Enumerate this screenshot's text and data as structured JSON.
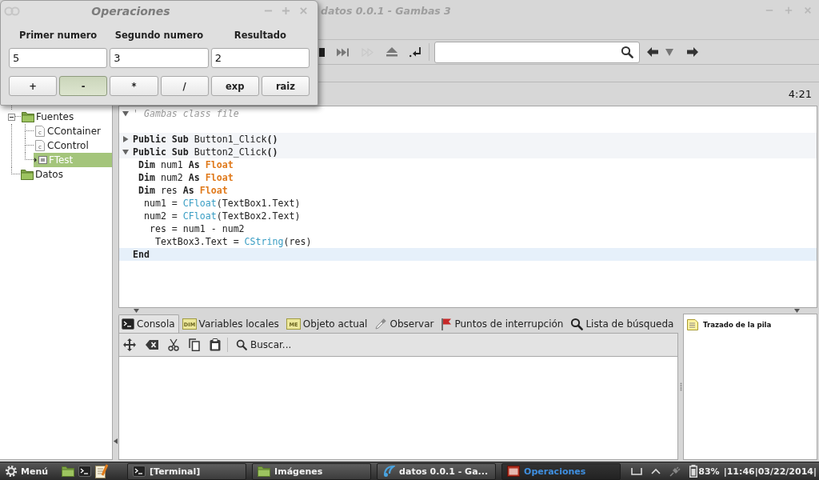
{
  "dialog": {
    "title": "Operaciones",
    "fields": [
      {
        "label": "Primer numero",
        "value": "5"
      },
      {
        "label": "Segundo numero",
        "value": "3"
      },
      {
        "label": "Resultado",
        "value": "2"
      }
    ],
    "buttons": [
      {
        "label": "+",
        "pressed": false
      },
      {
        "label": "-",
        "pressed": true
      },
      {
        "label": "*",
        "pressed": false
      },
      {
        "label": "/",
        "pressed": false
      },
      {
        "label": "exp",
        "pressed": false
      },
      {
        "label": "raiz",
        "pressed": false
      }
    ]
  },
  "main_window": {
    "title": "datos 0.0.1 - Gambas 3",
    "toolbar": {
      "buttons": [
        {
          "kind": "stop",
          "disabled": false
        },
        {
          "kind": "step",
          "disabled": false
        },
        {
          "kind": "forward",
          "disabled": true
        },
        {
          "kind": "eject",
          "disabled": false
        },
        {
          "kind": "return",
          "disabled": false
        }
      ],
      "navigation": [
        {
          "kind": "back"
        },
        {
          "kind": "history"
        },
        {
          "kind": "forward"
        }
      ]
    },
    "project_tree": {
      "items": [
        {
          "label": "Fuentes",
          "kind": "folder",
          "expanded": true,
          "selected": false,
          "children": [
            {
              "label": "CContainer",
              "kind": "class",
              "icon_label": "c",
              "selected": false
            },
            {
              "label": "CControl",
              "kind": "class",
              "icon_label": "c",
              "selected": false
            },
            {
              "label": "FTest",
              "kind": "form",
              "selected": true
            }
          ]
        },
        {
          "label": "Datos",
          "kind": "folder",
          "selected": false
        }
      ]
    },
    "editor": {
      "cursor_position": "4:21",
      "lines": [
        {
          "kind": "code",
          "expanded": true,
          "current": false,
          "tokens": [
            {
              "kind": "comment",
              "text": "' Gambas class file"
            }
          ]
        },
        {
          "kind": "blank",
          "current": false
        },
        {
          "kind": "procedure",
          "expanded": false,
          "current": false,
          "tokens": [
            {
              "kind": "keyword",
              "text": "Public Sub"
            },
            {
              "kind": "plain",
              "text": " Button1_Click"
            },
            {
              "kind": "symbol",
              "text": "()"
            }
          ]
        },
        {
          "kind": "procedure",
          "expanded": true,
          "current": false,
          "tokens": [
            {
              "kind": "keyword",
              "text": "Public Sub"
            },
            {
              "kind": "plain",
              "text": " Button2_Click"
            },
            {
              "kind": "symbol",
              "text": "()"
            }
          ]
        },
        {
          "kind": "code",
          "current": false,
          "tokens": [
            {
              "kind": "keyword",
              "text": " Dim"
            },
            {
              "kind": "plain",
              "text": " num1 "
            },
            {
              "kind": "keyword",
              "text": "As"
            },
            {
              "kind": "type",
              "text": " Float"
            }
          ]
        },
        {
          "kind": "code",
          "current": false,
          "tokens": [
            {
              "kind": "keyword",
              "text": " Dim"
            },
            {
              "kind": "plain",
              "text": " num2 "
            },
            {
              "kind": "keyword",
              "text": "As"
            },
            {
              "kind": "type",
              "text": " Float"
            }
          ]
        },
        {
          "kind": "code",
          "current": false,
          "tokens": [
            {
              "kind": "keyword",
              "text": " Dim"
            },
            {
              "kind": "plain",
              "text": " res "
            },
            {
              "kind": "keyword",
              "text": "As"
            },
            {
              "kind": "type",
              "text": " Float"
            }
          ]
        },
        {
          "kind": "code",
          "current": false,
          "tokens": [
            {
              "kind": "plain",
              "text": "  num1 = "
            },
            {
              "kind": "function",
              "text": "CFloat"
            },
            {
              "kind": "plain",
              "text": "(TextBox1.Text)"
            }
          ]
        },
        {
          "kind": "code",
          "current": false,
          "tokens": [
            {
              "kind": "plain",
              "text": "  num2 = "
            },
            {
              "kind": "function",
              "text": "CFloat"
            },
            {
              "kind": "plain",
              "text": "(TextBox2.Text)"
            }
          ]
        },
        {
          "kind": "code",
          "current": false,
          "tokens": [
            {
              "kind": "plain",
              "text": "   res = num1 - num2"
            }
          ]
        },
        {
          "kind": "code",
          "current": false,
          "tokens": [
            {
              "kind": "plain",
              "text": "    TextBox3.Text = "
            },
            {
              "kind": "function",
              "text": "CString"
            },
            {
              "kind": "plain",
              "text": "(res)"
            }
          ]
        },
        {
          "kind": "code",
          "current": true,
          "tokens": [
            {
              "kind": "keyword",
              "text": "End"
            }
          ]
        }
      ]
    },
    "debug_panel": {
      "tabs": [
        {
          "label": "Consola",
          "kind": "terminal",
          "selected": true
        },
        {
          "label": "Variables locales",
          "kind": "variables",
          "icon_label": "DIM",
          "selected": false
        },
        {
          "label": "Objeto actual",
          "kind": "object",
          "icon_label": "ME",
          "selected": false
        },
        {
          "label": "Observar",
          "kind": "watch",
          "selected": false
        },
        {
          "label": "Puntos de interrupción",
          "kind": "breakpoints",
          "selected": false
        },
        {
          "label": "Lista de búsqueda",
          "kind": "search",
          "selected": false
        }
      ],
      "console_tools": [
        {
          "kind": "move"
        },
        {
          "kind": "clear"
        },
        {
          "kind": "cut"
        },
        {
          "kind": "copy"
        },
        {
          "kind": "paste"
        }
      ],
      "find_button": {
        "label": "Buscar..."
      }
    },
    "stack_panel": {
      "title": "Trazado de la pila"
    }
  },
  "taskbar": {
    "menu_button": {
      "label": "Menú"
    },
    "launchers": [
      {
        "kind": "folder"
      },
      {
        "kind": "terminal"
      },
      {
        "kind": "editor"
      }
    ],
    "tasks": [
      {
        "label": "[Terminal]",
        "kind": "terminal",
        "selected": false
      },
      {
        "label": "Imágenes",
        "kind": "folder",
        "selected": false
      },
      {
        "label": "datos 0.0.1 - Ga...",
        "kind": "gambas",
        "selected": false
      },
      {
        "label": "Operaciones",
        "kind": "window",
        "selected": true
      }
    ],
    "tray": [
      {
        "kind": "desktop"
      },
      {
        "kind": "expand"
      },
      {
        "kind": "network"
      }
    ],
    "battery": "83%",
    "clock": "|11:46|03/22/2014|"
  }
}
